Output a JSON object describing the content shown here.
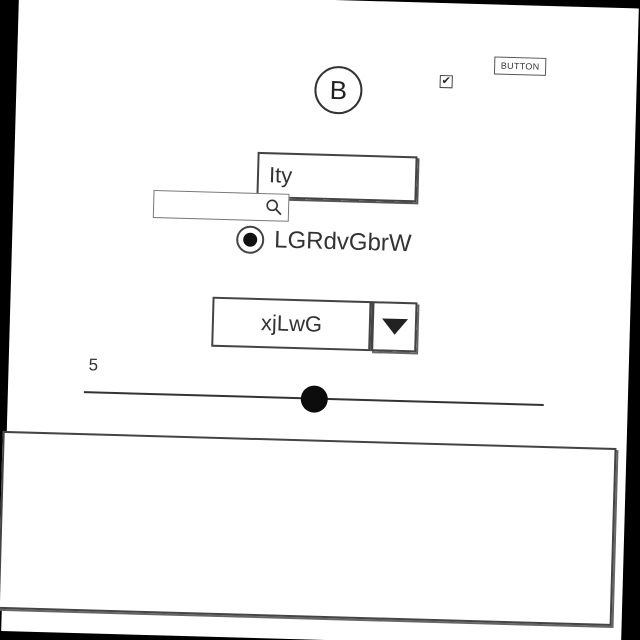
{
  "avatar": {
    "letter": "B"
  },
  "checkbox": {
    "checked": true,
    "mark": "✔"
  },
  "top_button": {
    "label": "BUTTON"
  },
  "text_input": {
    "value": "Ity"
  },
  "search": {
    "placeholder": "",
    "icon": "search-icon"
  },
  "radio": {
    "label": "LGRdvGbrW",
    "selected": true
  },
  "dropdown": {
    "value": "xjLwG",
    "icon": "caret-down-icon"
  },
  "slider": {
    "value": "5"
  },
  "textarea": {
    "value": ""
  }
}
